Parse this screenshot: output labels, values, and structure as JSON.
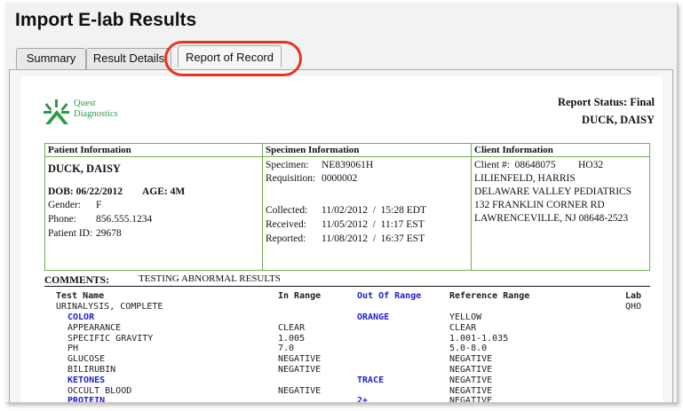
{
  "window": {
    "title": "Import E-lab Results"
  },
  "tabs": [
    {
      "label": "Summary"
    },
    {
      "label": "Result Details"
    },
    {
      "label": "Report of Record"
    }
  ],
  "report": {
    "logo_line1": "Quest",
    "logo_line2": "Diagnostics",
    "logo_color": "#2e9a47",
    "status": "Report Status: Final",
    "patient_name_header": "DUCK, DAISY",
    "patient": {
      "header": "Patient Information",
      "name": "DUCK, DAISY",
      "dob": "DOB: 06/22/2012",
      "age": "AGE: 4M",
      "gender_label": "Gender:",
      "gender": "F",
      "phone_label": "Phone:",
      "phone": "856.555.1234",
      "id_label": "Patient ID:",
      "id": "29678"
    },
    "specimen": {
      "header": "Specimen Information",
      "specimen_label": "Specimen:",
      "specimen": "NE839061H",
      "requisition_label": "Requisition:",
      "requisition": "0000002",
      "collected_label": "Collected:",
      "collected": "11/02/2012  /  15:28 EDT",
      "received_label": "Received:",
      "received": "11/05/2012  /  11:17 EST",
      "reported_label": "Reported:",
      "reported": "11/08/2012  /  16:37 EST"
    },
    "client": {
      "header": "Client Information",
      "client_no": "Client #:  08648075",
      "code": "HO32",
      "line1": "LILIENFELD, HARRIS",
      "line2": "DELAWARE VALLEY PEDIATRICS",
      "line3": "132 FRANKLIN CORNER RD",
      "line4": "LAWRENCEVILLE, NJ 08648-2523"
    },
    "comments_label": "COMMENTS:",
    "comments_value": "TESTING ABNORMAL RESULTS",
    "columns": {
      "test_name": "Test Name",
      "in_range": "In Range",
      "out_of_range": "Out Of Range",
      "reference_range": "Reference Range",
      "lab": "Lab"
    },
    "group": {
      "name": "URINALYSIS, COMPLETE",
      "lab": "QHO"
    },
    "rows": [
      {
        "name": "COLOR",
        "in": "",
        "out": "ORANGE",
        "ref": "YELLOW",
        "abnormal": true
      },
      {
        "name": "APPEARANCE",
        "in": "CLEAR",
        "out": "",
        "ref": "CLEAR",
        "abnormal": false
      },
      {
        "name": "SPECIFIC GRAVITY",
        "in": "1.005",
        "out": "",
        "ref": "1.001-1.035",
        "abnormal": false
      },
      {
        "name": "PH",
        "in": "7.0",
        "out": "",
        "ref": "5.0-8.0",
        "abnormal": false
      },
      {
        "name": "GLUCOSE",
        "in": "NEGATIVE",
        "out": "",
        "ref": "NEGATIVE",
        "abnormal": false
      },
      {
        "name": "BILIRUBIN",
        "in": "NEGATIVE",
        "out": "",
        "ref": "NEGATIVE",
        "abnormal": false
      },
      {
        "name": "KETONES",
        "in": "",
        "out": "TRACE",
        "ref": "NEGATIVE",
        "abnormal": true
      },
      {
        "name": "OCCULT BLOOD",
        "in": "NEGATIVE",
        "out": "",
        "ref": "NEGATIVE",
        "abnormal": false
      },
      {
        "name": "PROTEIN",
        "in": "",
        "out": "2+",
        "ref": "NEGATIVE",
        "abnormal": true
      }
    ],
    "abnormal_color": "#1f1fd4",
    "highlight_color": "#e8331e"
  }
}
